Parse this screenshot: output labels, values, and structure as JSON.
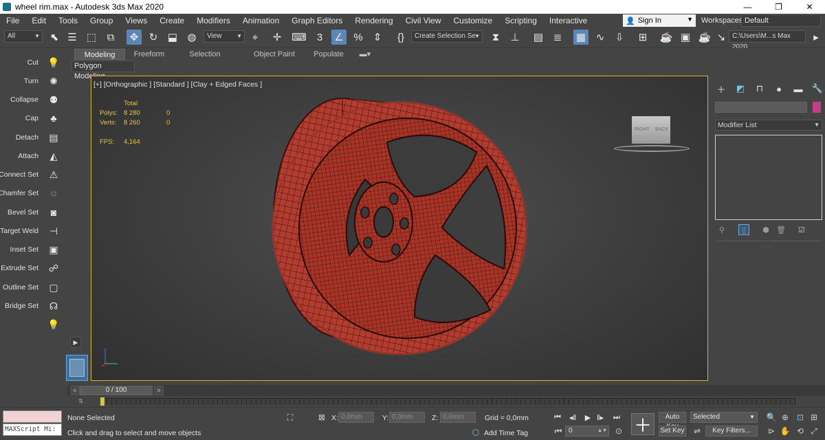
{
  "window": {
    "title": "wheel rim.max - Autodesk 3ds Max 2020",
    "minimize": "—",
    "maximize": "❐",
    "close": "✕"
  },
  "menu": [
    "File",
    "Edit",
    "Tools",
    "Group",
    "Views",
    "Create",
    "Modifiers",
    "Animation",
    "Graph Editors",
    "Rendering",
    "Civil View",
    "Customize",
    "Scripting",
    "Interactive"
  ],
  "signin": {
    "label": "Sign In"
  },
  "workspaces": {
    "label": "Workspaces:",
    "value": "Default"
  },
  "toolbar": {
    "selection_filter": "All",
    "reference_coord": "View",
    "named_selection_placeholder": "Create Selection Se",
    "project_path": "C:\\Users\\M...s Max 2020"
  },
  "ribbon": {
    "tabs": [
      "Modeling",
      "Freeform",
      "Selection",
      "Object Paint",
      "Populate"
    ],
    "active_tab": "Modeling",
    "sub_panel": "Polygon Modeling"
  },
  "left_panel": {
    "items": [
      {
        "label": "Cut",
        "icon": "cut-icon"
      },
      {
        "label": "Turn",
        "icon": "turn-icon"
      },
      {
        "label": "Collapse",
        "icon": "collapse-icon"
      },
      {
        "label": "Cap",
        "icon": "cap-icon"
      },
      {
        "label": "Detach",
        "icon": "detach-icon"
      },
      {
        "label": "Attach",
        "icon": "attach-icon"
      },
      {
        "label": "Connect Set",
        "icon": "connect-set-icon"
      },
      {
        "label": "Chamfer Set",
        "icon": "chamfer-set-icon"
      },
      {
        "label": "Bevel Set",
        "icon": "bevel-set-icon"
      },
      {
        "label": "Target Weld",
        "icon": "target-weld-icon"
      },
      {
        "label": "Inset Set",
        "icon": "inset-set-icon"
      },
      {
        "label": "Extrude Set",
        "icon": "extrude-set-icon"
      },
      {
        "label": "Outline Set",
        "icon": "outline-set-icon"
      },
      {
        "label": "Bridge Set",
        "icon": "bridge-set-icon"
      }
    ]
  },
  "viewport": {
    "label": "[+] [Orthographic ] [Standard ] [Clay + Edged Faces ]",
    "stats": {
      "total_header": "Total",
      "polys_label": "Polys:",
      "polys_total": "8 280",
      "polys_sel": "0",
      "verts_label": "Verts:",
      "verts_total": "8 260",
      "verts_sel": "0",
      "fps_label": "FPS:",
      "fps_value": "4,164"
    },
    "viewcube": {
      "left": "RIGHT",
      "right": "BACK"
    },
    "mesh_color": "#b23c2f"
  },
  "right_panel": {
    "modifier_list": "Modifier List",
    "object_color": "#c33e8a"
  },
  "timeline": {
    "frame_range": "0 / 100",
    "prev": "<",
    "next": ">"
  },
  "status": {
    "maxscript": "MAXScript Mi:",
    "selection": "None Selected",
    "prompt": "Click and drag to select and move objects",
    "x_label": "X:",
    "x_value": "0,0mm",
    "y_label": "Y:",
    "y_value": "0,0mm",
    "z_label": "Z:",
    "z_value": "0,0mm",
    "grid": "Grid = 0,0mm",
    "add_time_tag": "Add Time Tag",
    "frame": "0",
    "auto_key": "Auto Key",
    "set_key": "Set Key",
    "selected": "Selected",
    "key_filters": "Key Filters..."
  }
}
